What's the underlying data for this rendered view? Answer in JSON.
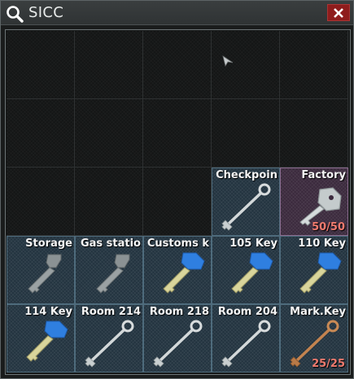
{
  "window": {
    "search_query": "SICC",
    "icons": {
      "search": "search-icon",
      "close": "close-icon"
    }
  },
  "colors": {
    "item_bg_blue": "#233440",
    "item_bg_violet": "#3b2a3d",
    "count_text": "#f07a6e",
    "close_button": "#8e1c1c"
  },
  "items": [
    {
      "name": "Checkpoin",
      "icon": "key-icon",
      "style": "silver",
      "count": ""
    },
    {
      "name": "Factory",
      "icon": "key-icon",
      "style": "silver-large",
      "count": "50/50"
    },
    {
      "name": "Storage",
      "icon": "key-icon",
      "style": "gray",
      "count": ""
    },
    {
      "name": "Gas statio",
      "icon": "key-icon",
      "style": "gray",
      "count": ""
    },
    {
      "name": "Customs k",
      "icon": "key-icon",
      "style": "blue",
      "count": ""
    },
    {
      "name": "105 Key",
      "icon": "key-icon",
      "style": "blue",
      "count": ""
    },
    {
      "name": "110 Key",
      "icon": "key-icon",
      "style": "blue",
      "count": ""
    },
    {
      "name": "114 Key",
      "icon": "key-icon",
      "style": "blue",
      "count": ""
    },
    {
      "name": "Room 214",
      "icon": "key-icon",
      "style": "silver",
      "count": ""
    },
    {
      "name": "Room 218",
      "icon": "key-icon",
      "style": "silver",
      "count": ""
    },
    {
      "name": "Room 204",
      "icon": "key-icon",
      "style": "silver",
      "count": ""
    },
    {
      "name": "Mark.Key",
      "icon": "key-icon",
      "style": "bronze",
      "count": "25/25"
    }
  ]
}
